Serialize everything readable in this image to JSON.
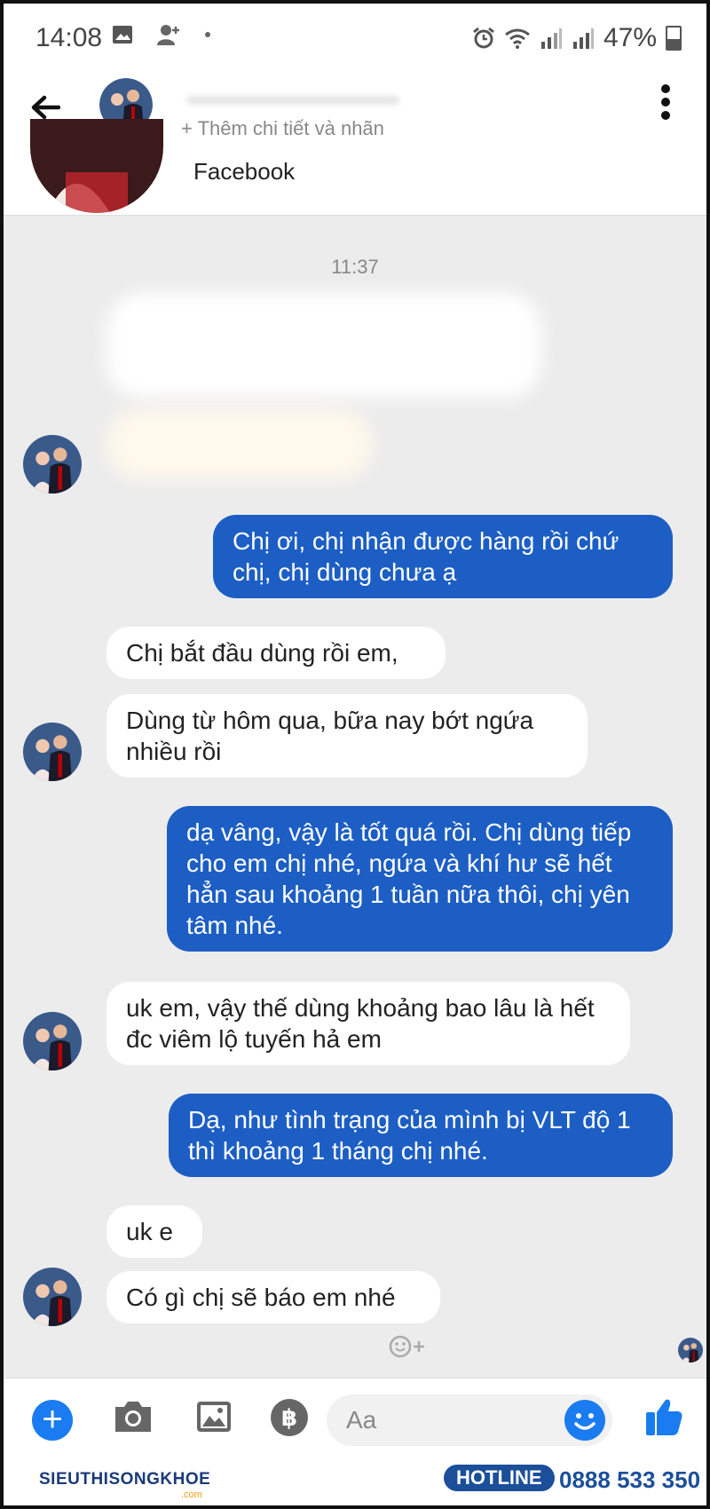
{
  "status_bar": {
    "time": "14:08",
    "battery": "47%"
  },
  "header": {
    "subtitle": "+ Thêm chi tiết và nhãn"
  },
  "profile": {
    "label": "Facebook"
  },
  "chat": {
    "timestamp": "11:37",
    "messages": [
      {
        "from": "them",
        "text": "Chị bắt đầu dùng rồi em,"
      },
      {
        "from": "them",
        "text": "Dùng từ hôm qua, bữa nay bớt ngứa nhiều rồi"
      },
      {
        "from": "me",
        "text": "Chị ơi, chị nhận được hàng rồi chứ chị, chị dùng chưa ạ"
      },
      {
        "from": "me",
        "text": "dạ vâng, vậy là tốt quá rồi. Chị dùng tiếp cho em chị nhé, ngứa và khí hư sẽ hết hẳn sau khoảng 1 tuần nữa thôi, chị yên tâm nhé."
      },
      {
        "from": "them",
        "text": "uk em, vậy thế dùng khoảng bao lâu là hết đc viêm lộ tuyến hả em"
      },
      {
        "from": "me",
        "text": "Dạ, như tình trạng của mình bị VLT độ 1 thì khoảng 1 tháng chị nhé."
      },
      {
        "from": "them",
        "text": "uk e"
      },
      {
        "from": "them",
        "text": "Có gì chị sẽ báo em nhé"
      }
    ]
  },
  "composer": {
    "placeholder": "Aa"
  },
  "banner": {
    "brand": "SIEUTHISONGKHOE",
    "brand_sub": ".com",
    "hotline_label": "HOTLINE",
    "hotline_number": "0888 533 350"
  },
  "colors": {
    "outgoing": "#1c5ec4",
    "incoming": "#ffffff",
    "accent": "#1a7cf0"
  },
  "icons": [
    "back-arrow-icon",
    "more-vertical-icon",
    "plus-icon",
    "camera-icon",
    "image-icon",
    "payment-icon",
    "emoji-icon",
    "thumbs-up-icon"
  ]
}
